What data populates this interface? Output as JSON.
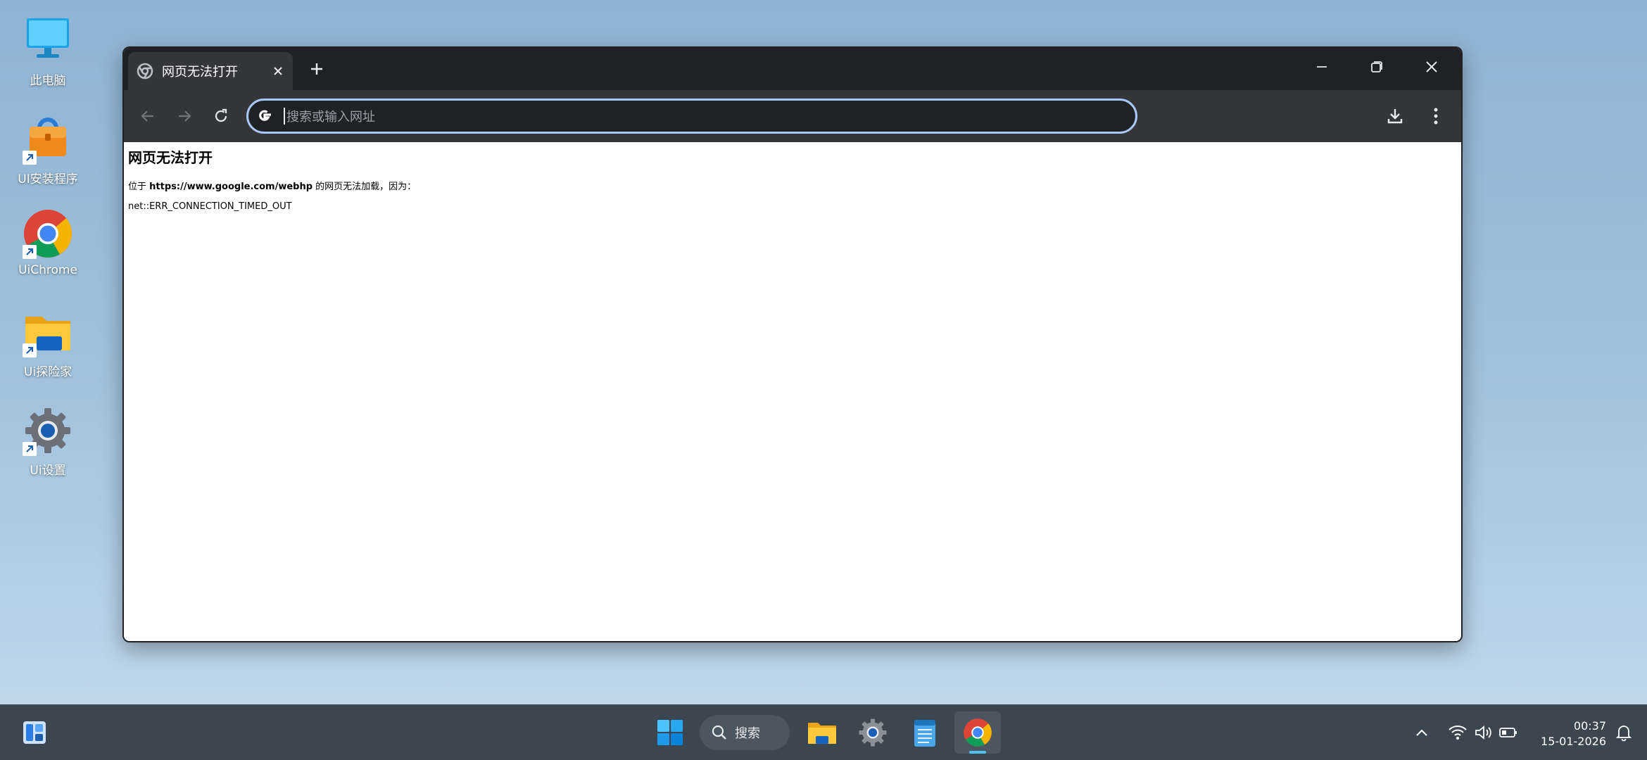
{
  "desktop": {
    "icons": [
      {
        "label": "此电脑",
        "icon": "computer-icon"
      },
      {
        "label": "UI安装程序",
        "icon": "installer-icon"
      },
      {
        "label": "UiChrome",
        "icon": "chrome-icon"
      },
      {
        "label": "Ui探险家",
        "icon": "folder-icon"
      },
      {
        "label": "Ui设置",
        "icon": "gear-icon"
      }
    ]
  },
  "browser": {
    "tab": {
      "title": "网页无法打开",
      "icon": "chrome-tab-icon"
    },
    "omnibox": {
      "placeholder": "搜索或输入网址",
      "value": ""
    },
    "page": {
      "heading": "网页无法打开",
      "message_prefix": "位于",
      "url": "https://www.google.com/webhp",
      "message_suffix": "的网页无法加载，因为：",
      "error_code": "net::ERR_CONNECTION_TIMED_OUT"
    }
  },
  "taskbar": {
    "search_label": "搜索",
    "time": "00:37",
    "date": "15-01-2026",
    "apps": [
      "start-icon",
      "file-explorer-icon",
      "settings-icon",
      "notepad-icon",
      "chrome-icon"
    ]
  },
  "colors": {
    "titlebar": "#202124",
    "toolbar": "#35363a",
    "omnibox_border": "#a8c7fa",
    "taskbar": "#3b4650"
  }
}
